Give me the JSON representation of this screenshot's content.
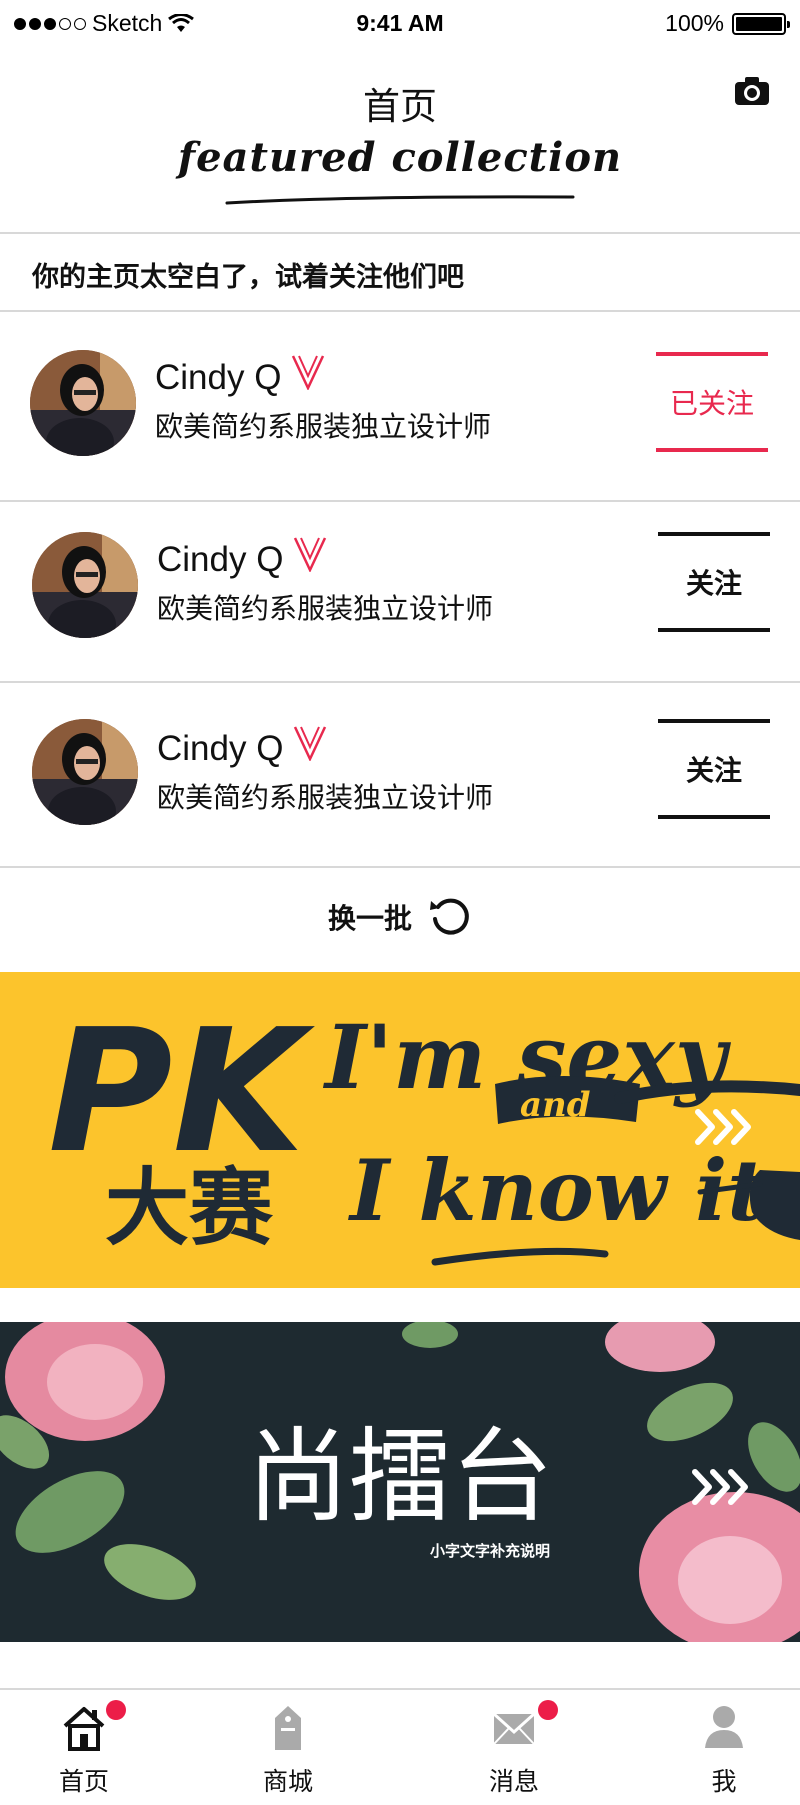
{
  "status_bar": {
    "carrier": "Sketch",
    "time": "9:41 AM",
    "battery": "100%"
  },
  "header": {
    "title": "首页",
    "featured": "featured collection"
  },
  "empty_hint": "你的主页太空白了，试着关注他们吧",
  "suggestions": [
    {
      "name": "Cindy Q",
      "bio": "欧美简约系服装独立设计师",
      "follow_label": "已关注",
      "followed": true
    },
    {
      "name": "Cindy Q",
      "bio": "欧美简约系服装独立设计师",
      "follow_label": "关注",
      "followed": false
    },
    {
      "name": "Cindy Q",
      "bio": "欧美简约系服装独立设计师",
      "follow_label": "关注",
      "followed": false
    }
  ],
  "refresh_label": "换一批",
  "banners": {
    "pk": {
      "big": "PK",
      "cn": "大赛",
      "line1": "I'm sexy",
      "and": "and",
      "line2": "I know it"
    },
    "shang": {
      "title": "尚擂台",
      "subtitle": "小字文字补充说明"
    }
  },
  "tabbar": {
    "items": [
      {
        "label": "首页",
        "icon": "home-icon",
        "badge": true
      },
      {
        "label": "商城",
        "icon": "shop-tag-icon",
        "badge": false
      },
      {
        "label": "消息",
        "icon": "mail-icon",
        "badge": true
      },
      {
        "label": "我",
        "icon": "user-icon",
        "badge": false
      }
    ]
  },
  "colors": {
    "accent": "#e8294e",
    "banner_yellow": "#fcc42c",
    "banner_dark": "#1e2a30",
    "badge": "#ec1d48"
  }
}
